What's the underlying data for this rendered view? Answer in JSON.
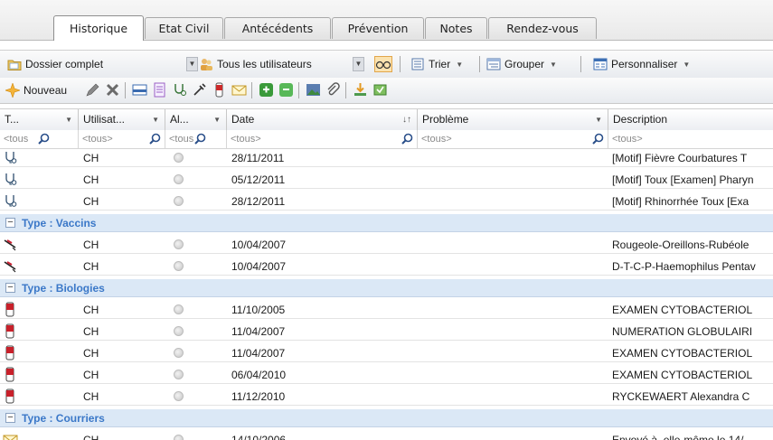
{
  "tabs": [
    "Historique",
    "Etat Civil",
    "Antécédents",
    "Prévention",
    "Notes",
    "Rendez-vous"
  ],
  "toolbar1": {
    "dossier_label": "Dossier complet",
    "users_label": "Tous les utilisateurs",
    "trier_label": "Trier",
    "grouper_label": "Grouper",
    "personnaliser_label": "Personnaliser"
  },
  "toolbar2": {
    "nouveau_label": "Nouveau"
  },
  "columns": [
    {
      "label": "T...",
      "filter": "<tous"
    },
    {
      "label": "Utilisat...",
      "filter": "<tous>"
    },
    {
      "label": "Al...",
      "filter": "<tous"
    },
    {
      "label": "Date",
      "filter": "<tous>"
    },
    {
      "label": "Problème",
      "filter": "<tous>"
    },
    {
      "label": "Description",
      "filter": "<tous>"
    }
  ],
  "rows": [
    {
      "kind": "item",
      "icon": "stethoscope-icon",
      "user": "CH",
      "date": "28/11/2011",
      "problem": "",
      "description": "[Motif] Fièvre  Courbatures  T"
    },
    {
      "kind": "item",
      "icon": "stethoscope-icon",
      "user": "CH",
      "date": "05/12/2011",
      "problem": "",
      "description": "[Motif] Toux [Examen] Pharyn"
    },
    {
      "kind": "item",
      "icon": "stethoscope-icon",
      "user": "CH",
      "date": "28/12/2011",
      "problem": "",
      "description": "[Motif] Rhinorrhée  Toux [Exa"
    },
    {
      "kind": "group",
      "label": "Type : Vaccins"
    },
    {
      "kind": "item",
      "icon": "syringe-icon",
      "user": "CH",
      "date": "10/04/2007",
      "problem": "",
      "description": "Rougeole-Oreillons-Rubéole"
    },
    {
      "kind": "item",
      "icon": "syringe-icon",
      "user": "CH",
      "date": "10/04/2007",
      "problem": "",
      "description": "D-T-C-P-Haemophilus Pentav"
    },
    {
      "kind": "group",
      "label": "Type : Biologies"
    },
    {
      "kind": "item",
      "icon": "test-tube-icon",
      "user": "CH",
      "date": "11/10/2005",
      "problem": "",
      "description": "EXAMEN CYTOBACTERIOL"
    },
    {
      "kind": "item",
      "icon": "test-tube-icon",
      "user": "CH",
      "date": "11/04/2007",
      "problem": "",
      "description": "NUMERATION GLOBULAIRI"
    },
    {
      "kind": "item",
      "icon": "test-tube-icon",
      "user": "CH",
      "date": "11/04/2007",
      "problem": "",
      "description": "EXAMEN CYTOBACTERIOL"
    },
    {
      "kind": "item",
      "icon": "test-tube-icon",
      "user": "CH",
      "date": "06/04/2010",
      "problem": "",
      "description": "EXAMEN CYTOBACTERIOL"
    },
    {
      "kind": "item",
      "icon": "test-tube-icon",
      "user": "CH",
      "date": "11/12/2010",
      "problem": "",
      "description": "RYCKEWAERT Alexandra  C"
    },
    {
      "kind": "group",
      "label": "Type : Courriers"
    },
    {
      "kind": "item",
      "icon": "letter-icon",
      "user": "CH",
      "date": "14/10/2006",
      "problem": "",
      "description": "Envoyé à .elle-même  le 14/"
    }
  ],
  "colors": {
    "group_bg": "#dbe8f6",
    "group_text": "#3b78c8",
    "accent_orange": "#e8a23a"
  }
}
